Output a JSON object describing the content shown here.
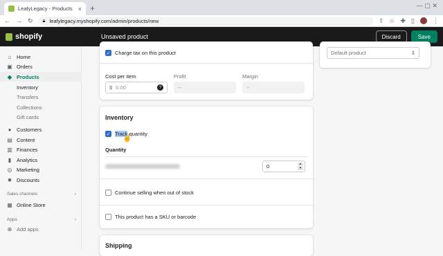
{
  "browser": {
    "tab_title": "LeafyLegacy - Products · New",
    "url": "leafylegacy.myshopify.com/admin/products/new",
    "new_tab": "+",
    "close": "×"
  },
  "topbar": {
    "logo": "shopify",
    "heading": "Unsaved product",
    "discard_label": "Discard",
    "save_label": "Save"
  },
  "sidebar": {
    "items": [
      {
        "label": "Home",
        "icon": "home-icon"
      },
      {
        "label": "Orders",
        "icon": "orders-icon"
      },
      {
        "label": "Products",
        "icon": "tag-icon"
      }
    ],
    "product_subitems": [
      "Inventory",
      "Transfers",
      "Collections",
      "Gift cards"
    ],
    "items2": [
      {
        "label": "Customers",
        "icon": "person-icon"
      },
      {
        "label": "Content",
        "icon": "content-icon"
      },
      {
        "label": "Finances",
        "icon": "bank-icon"
      },
      {
        "label": "Analytics",
        "icon": "chart-icon"
      },
      {
        "label": "Marketing",
        "icon": "target-icon"
      },
      {
        "label": "Discounts",
        "icon": "discount-icon"
      }
    ],
    "sales_channels_label": "Sales channels",
    "online_store": "Online Store",
    "apps_label": "Apps",
    "add_apps": "Add apps"
  },
  "pricing": {
    "charge_tax": "Charge tax on this product",
    "cost_label": "Cost per item",
    "profit_label": "Profit",
    "margin_label": "Margin",
    "currency": "$",
    "cost_placeholder": "0.00",
    "profit_value": "--",
    "margin_value": "--"
  },
  "right_panel": {
    "template_value": "Default product"
  },
  "inventory": {
    "title": "Inventory",
    "track_quantity_highlight": "Track",
    "track_quantity_rest": " quantity",
    "quantity_label": "Quantity",
    "quantity_value": "0",
    "continue_selling": "Continue selling when out of stock",
    "sku_barcode": "This product has a SKU or barcode"
  },
  "shipping": {
    "title": "Shipping"
  }
}
